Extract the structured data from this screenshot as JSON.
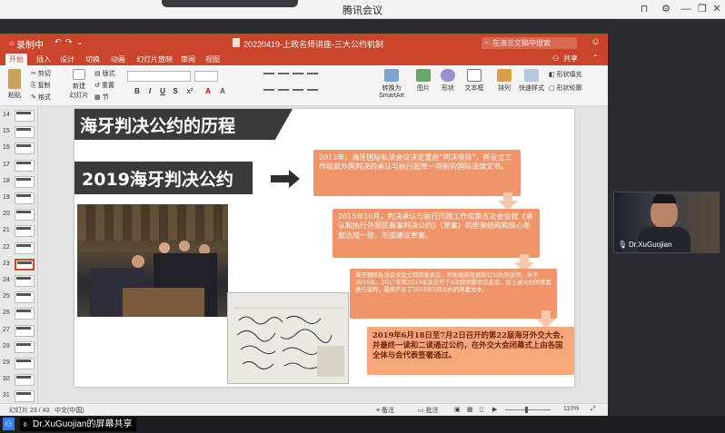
{
  "meeting": {
    "title": "腾讯会议",
    "sharer_label": "Dr.XuGuojian的屏幕共享",
    "participant_name": "Dr.XuGuojian",
    "recording_label": "录制中"
  },
  "ppt": {
    "doc_title": "20220419-上政名师讲座-三大公约机制",
    "search_placeholder": "在演示文稿中搜索",
    "tabs": [
      "开始",
      "插入",
      "设计",
      "切换",
      "动画",
      "幻灯片放映",
      "审阅",
      "视图"
    ],
    "share_label": "共享",
    "ribbon": {
      "paste": "粘贴",
      "cut": "剪切",
      "copy": "复制",
      "format": "格式",
      "new_slide_1": "新建",
      "new_slide_2": "幻灯片",
      "layout": "版式",
      "reset": "重置",
      "section": "节",
      "convert_1": "转换为",
      "convert_2": "SmartArt",
      "picture": "图片",
      "shape": "形状",
      "textbox": "文本框",
      "arrange": "排列",
      "quick_styles": "快速样式",
      "shape_fill": "形状填充",
      "shape_outline": "形状轮廓"
    },
    "thumbnails": [
      "14",
      "15",
      "16",
      "17",
      "18",
      "19",
      "20",
      "21",
      "22",
      "23",
      "24",
      "25",
      "26",
      "27",
      "28",
      "29",
      "30",
      "31"
    ],
    "active_thumbnail": "23",
    "status": {
      "slide_info": "幻灯片 23 / 43",
      "language": "中文(中国)",
      "notes": "备注",
      "comments": "批注",
      "zoom": "110%"
    }
  },
  "slide": {
    "heading": "海牙判决公约的历程",
    "subheading": "2019海牙判决公约",
    "timeline": [
      "2012年，海牙国际私法会议决定重启“判决项目”，并设立工作组就外国判决的承认与执行起草一项新的国际法律文书。",
      "2015年10月，判决承认与执行问题工作组第五次会议就《承认和执行外国民商事判决公约》（草案）的框架结构和核心条款达成一致，形成建议草案。",
      "海牙国际私法会议设立特别委员会，开始政府层面制订公约的谈判，并于2016年、2017年和2018年共召开了4次特别委员会会议，对上述公约的草案进行谈判，最终产生了2018年5月公约的草案文本。",
      "2019年6月18日至7月2日召开的第22届海牙外交大会，并最终一读和二读通过公约，在外交大会闭幕式上由各国全体与会代表签署通过。"
    ]
  },
  "colors": {
    "ppt_accent": "#c9442a",
    "timeline_orange": "#f0956a",
    "heading_dark": "#3a3a3a"
  }
}
